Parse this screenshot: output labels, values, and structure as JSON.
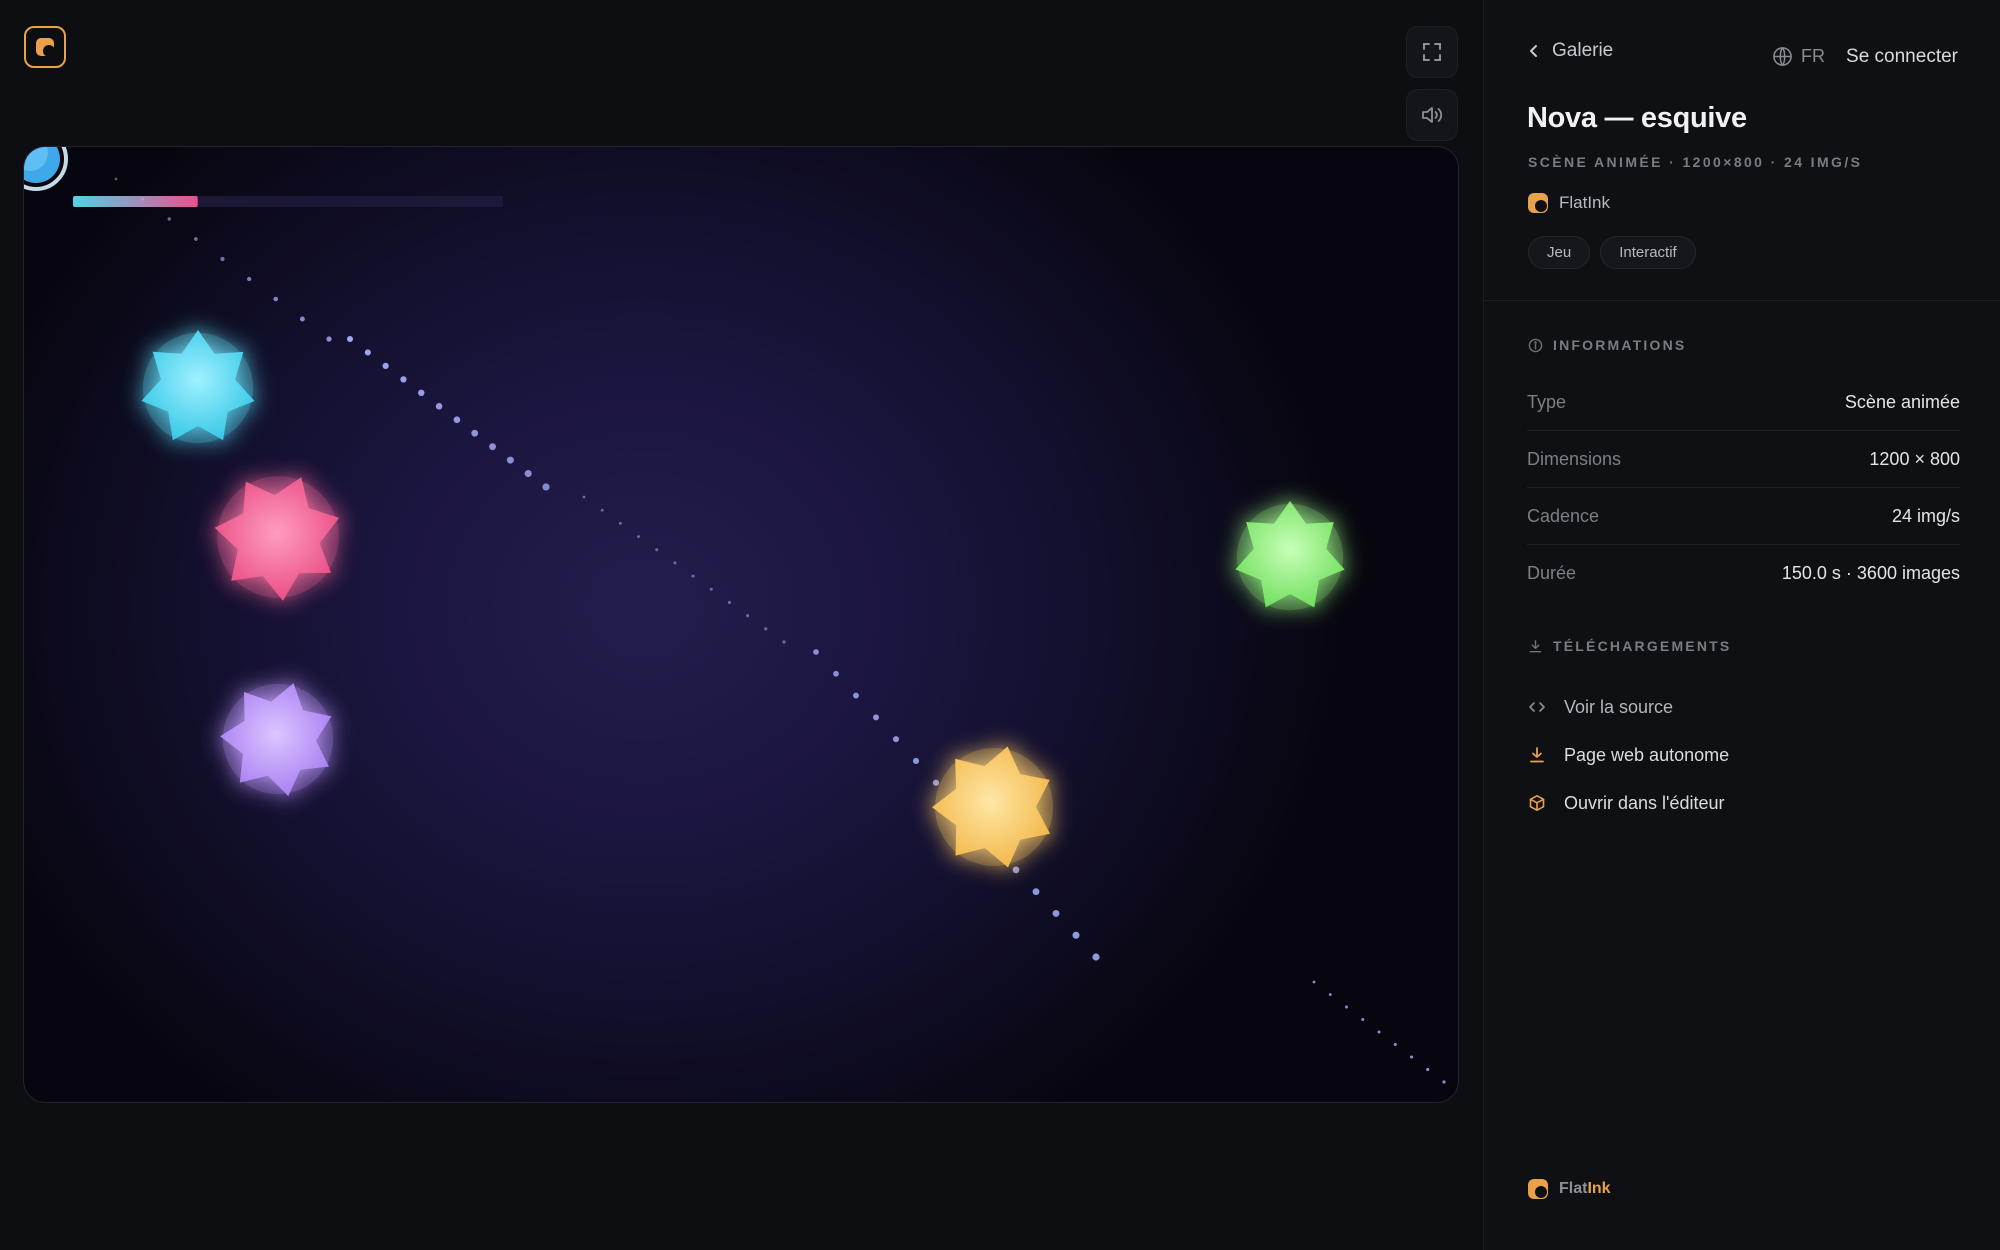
{
  "stage": {
    "logo_icon": "flatink-logo-icon",
    "fullscreen_icon": "fullscreen-icon",
    "sound_icon": "speaker-icon",
    "progress": 0.29,
    "progress_colors": [
      "#4fd4e6",
      "#ec4f8e"
    ]
  },
  "panel": {
    "back_label": "Galerie",
    "lang_label": "FR",
    "signin_label": "Se connecter",
    "title": "Nova — esquive",
    "subtitle": "SCÈNE ANIMÉE · 1200×800 · 24 IMG/S",
    "author": "FlatInk",
    "tags": [
      "Jeu",
      "Interactif"
    ],
    "info_heading": "INFORMATIONS",
    "info": [
      {
        "key": "Type",
        "value": "Scène animée"
      },
      {
        "key": "Dimensions",
        "value": "1200 × 800"
      },
      {
        "key": "Cadence",
        "value": "24 img/s"
      },
      {
        "key": "Durée",
        "value": "150.0 s · 3600 images"
      }
    ],
    "downloads_heading": "TÉLÉCHARGEMENTS",
    "downloads": [
      {
        "label": "Voir la source",
        "icon": "code-icon"
      },
      {
        "label": "Page web autonome",
        "icon": "download-icon"
      },
      {
        "label": "Ouvrir dans l'éditeur",
        "icon": "box-icon"
      }
    ],
    "footer_brand_a": "Flat",
    "footer_brand_b": "Ink"
  },
  "colors": {
    "accent": "#e9a24a",
    "star_cyan": "#56d8f0",
    "star_pink": "#f0609a",
    "star_purple": "#b58af5",
    "star_yellow": "#f7c65e",
    "star_green": "#8ae676"
  }
}
